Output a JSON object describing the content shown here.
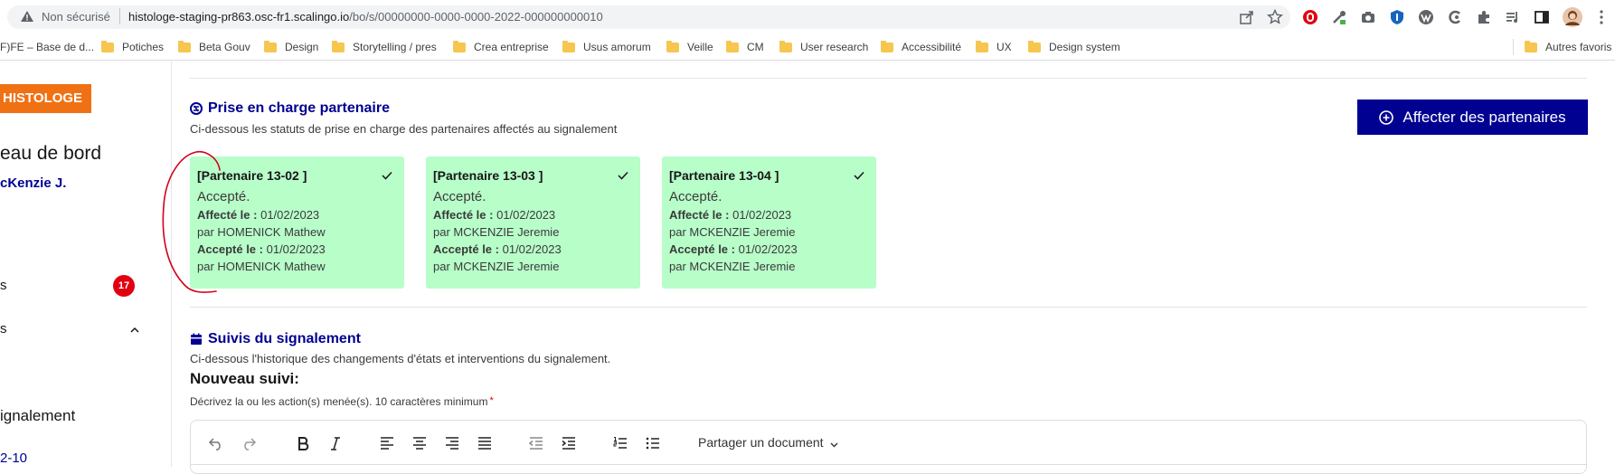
{
  "browser": {
    "security_label": "Non sécurisé",
    "url_host": "histologe-staging-pr863.osc-fr1.scalingo.io",
    "url_path": "/bo/s/00000000-0000-0000-2022-000000000010",
    "bookmarks": [
      {
        "label": "F)FE – Base de d...",
        "folder": false
      },
      {
        "label": "Potiches",
        "folder": true
      },
      {
        "label": "Beta Gouv",
        "folder": true
      },
      {
        "label": "Design",
        "folder": true
      },
      {
        "label": "Storytelling / pres",
        "folder": true
      },
      {
        "label": "Crea entreprise",
        "folder": true
      },
      {
        "label": "Usus amorum",
        "folder": true
      },
      {
        "label": "Veille",
        "folder": true
      },
      {
        "label": "CM",
        "folder": true
      },
      {
        "label": "User research",
        "folder": true
      },
      {
        "label": "Accessibilité",
        "folder": true
      },
      {
        "label": "UX",
        "folder": true
      },
      {
        "label": "Design system",
        "folder": true
      }
    ],
    "other_bookmarks": "Autres favoris"
  },
  "sidebar": {
    "logo": "HISTOLOGE",
    "dashboard_title": "eau de bord",
    "user_name": "cKenzie J.",
    "nav_item_1": "s",
    "nav_badge": "17",
    "nav_item_2": "s",
    "nav_item_3": "ignalement",
    "nav_item_4": "2-10"
  },
  "partners_section": {
    "title": "Prise en charge partenaire",
    "description": "Ci-dessous les statuts de prise en charge des partenaires affectés au signalement",
    "assign_button": "Affecter des partenaires",
    "cards": [
      {
        "name": "[Partenaire 13-02 ]",
        "status": "Accepté.",
        "assigned_label": "Affecté le :",
        "assigned_date": "01/02/2023",
        "assigned_by": "par HOMENICK Mathew",
        "accepted_label": "Accepté le :",
        "accepted_date": "01/02/2023",
        "accepted_by": "par HOMENICK Mathew"
      },
      {
        "name": "[Partenaire 13-03 ]",
        "status": "Accepté.",
        "assigned_label": "Affecté le :",
        "assigned_date": "01/02/2023",
        "assigned_by": "par MCKENZIE Jeremie",
        "accepted_label": "Accepté le :",
        "accepted_date": "01/02/2023",
        "accepted_by": "par MCKENZIE Jeremie"
      },
      {
        "name": "[Partenaire 13-04 ]",
        "status": "Accepté.",
        "assigned_label": "Affecté le :",
        "assigned_date": "01/02/2023",
        "assigned_by": "par MCKENZIE Jeremie",
        "accepted_label": "Accepté le :",
        "accepted_date": "01/02/2023",
        "accepted_by": "par MCKENZIE Jeremie"
      }
    ]
  },
  "followups_section": {
    "title": "Suivis du signalement",
    "description": "Ci-dessous l'historique des changements d'états et interventions du signalement.",
    "new_followup_title": "Nouveau suivi:",
    "hint": "Décrivez la ou les action(s) menée(s). 10 caractères minimum",
    "required_mark": "*",
    "share_document": "Partager un document"
  },
  "colors": {
    "primary": "#000091",
    "card_bg": "#b8fec9",
    "logo_bg": "#f07113",
    "badge": "#e1000f",
    "annotation": "#d0021b"
  }
}
